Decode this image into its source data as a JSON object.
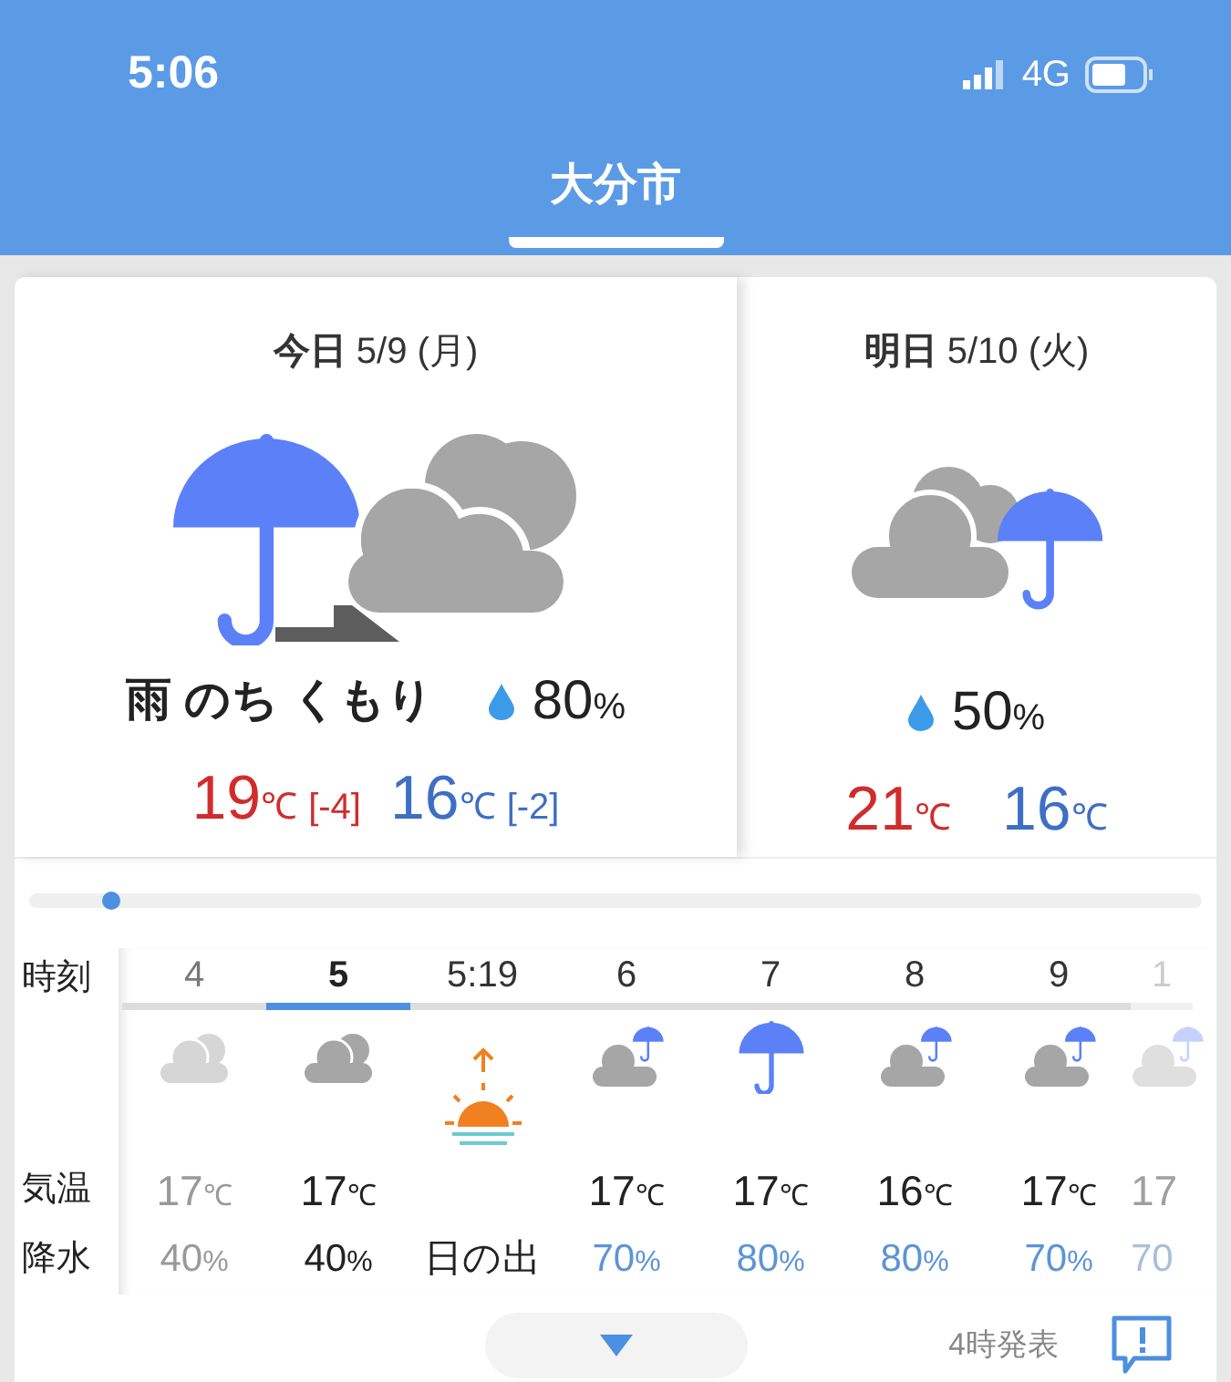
{
  "status_bar": {
    "time": "5:06",
    "network": "4G"
  },
  "header": {
    "title": "大分市",
    "selected": true
  },
  "days": [
    {
      "label_bold": "今日",
      "date": "5/9",
      "weekday": "(月)",
      "kind": "rain_then_cloudy",
      "weather": "雨 のち くもり",
      "precip": "80",
      "precip_unit": "%",
      "high": "19",
      "high_unit": "℃",
      "high_diff": "[-4]",
      "low": "16",
      "low_unit": "℃",
      "low_diff": "[-2]"
    },
    {
      "label_bold": "明日",
      "date": "5/10",
      "weekday": "(火)",
      "kind": "cloudy_rain",
      "precip": "50",
      "precip_unit": "%",
      "high": "21",
      "high_unit": "℃",
      "low": "16",
      "low_unit": "℃"
    }
  ],
  "hourly": {
    "row_labels": [
      "時刻",
      "気温",
      "降水"
    ],
    "columns": [
      {
        "time": "4",
        "kind": "cloudy",
        "temp": "17",
        "unit": "℃",
        "rain": "40",
        "rain_unit": "%",
        "selected": false,
        "past": true,
        "wet": false,
        "faded": false
      },
      {
        "time": "5",
        "kind": "cloudy",
        "temp": "17",
        "unit": "℃",
        "rain": "40",
        "rain_unit": "%",
        "selected": true,
        "past": false,
        "wet": false,
        "faded": false
      },
      {
        "time": "5:19",
        "kind": "sunrise",
        "event": "日の出",
        "selected": false,
        "faded": false
      },
      {
        "time": "6",
        "kind": "cloud_umbrella",
        "temp": "17",
        "unit": "℃",
        "rain": "70",
        "rain_unit": "%",
        "selected": false,
        "past": false,
        "wet": true,
        "faded": false
      },
      {
        "time": "7",
        "kind": "umbrella",
        "temp": "17",
        "unit": "℃",
        "rain": "80",
        "rain_unit": "%",
        "selected": false,
        "past": false,
        "wet": true,
        "faded": false
      },
      {
        "time": "8",
        "kind": "cloud_umbrella",
        "temp": "16",
        "unit": "℃",
        "rain": "80",
        "rain_unit": "%",
        "selected": false,
        "past": false,
        "wet": true,
        "faded": false
      },
      {
        "time": "9",
        "kind": "cloud_umbrella",
        "temp": "17",
        "unit": "℃",
        "rain": "70",
        "rain_unit": "%",
        "selected": false,
        "past": false,
        "wet": true,
        "faded": false
      },
      {
        "time": "1",
        "kind": "cloud_umbrella",
        "temp": "17",
        "rain": "70",
        "selected": false,
        "past": false,
        "wet": true,
        "faded": true
      }
    ]
  },
  "footer": {
    "issued": "4時発表"
  }
}
